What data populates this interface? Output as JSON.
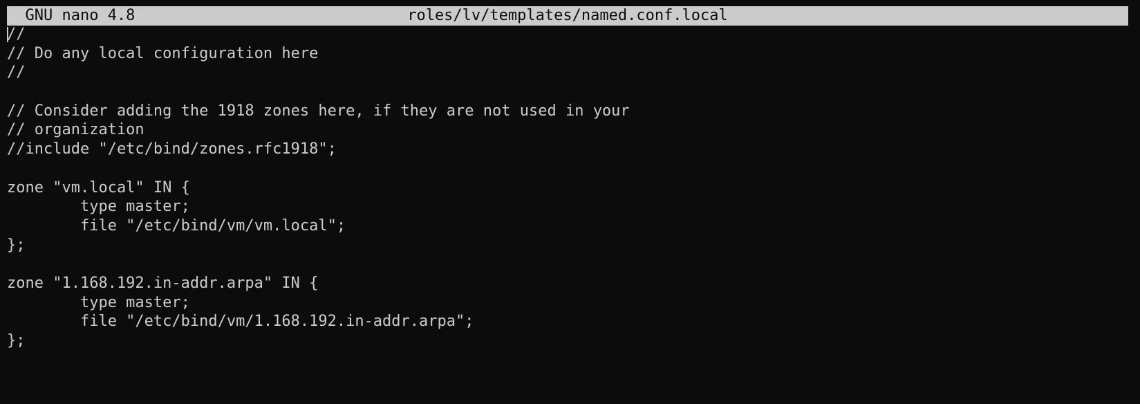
{
  "titlebar": {
    "version": "  GNU nano 4.8",
    "filename": "roles/lv/templates/named.conf.local"
  },
  "editor": {
    "lines": [
      "//",
      "// Do any local configuration here",
      "//",
      "",
      "// Consider adding the 1918 zones here, if they are not used in your",
      "// organization",
      "//include \"/etc/bind/zones.rfc1918\";",
      "",
      "zone \"vm.local\" IN {",
      "        type master;",
      "        file \"/etc/bind/vm/vm.local\";",
      "};",
      "",
      "zone \"1.168.192.in-addr.arpa\" IN {",
      "        type master;",
      "        file \"/etc/bind/vm/1.168.192.in-addr.arpa\";",
      "};"
    ]
  },
  "colors": {
    "background": "#0c0c0c",
    "foreground": "#cccccc",
    "titlebar_bg": "#cccccc",
    "titlebar_fg": "#0c0c0c"
  }
}
